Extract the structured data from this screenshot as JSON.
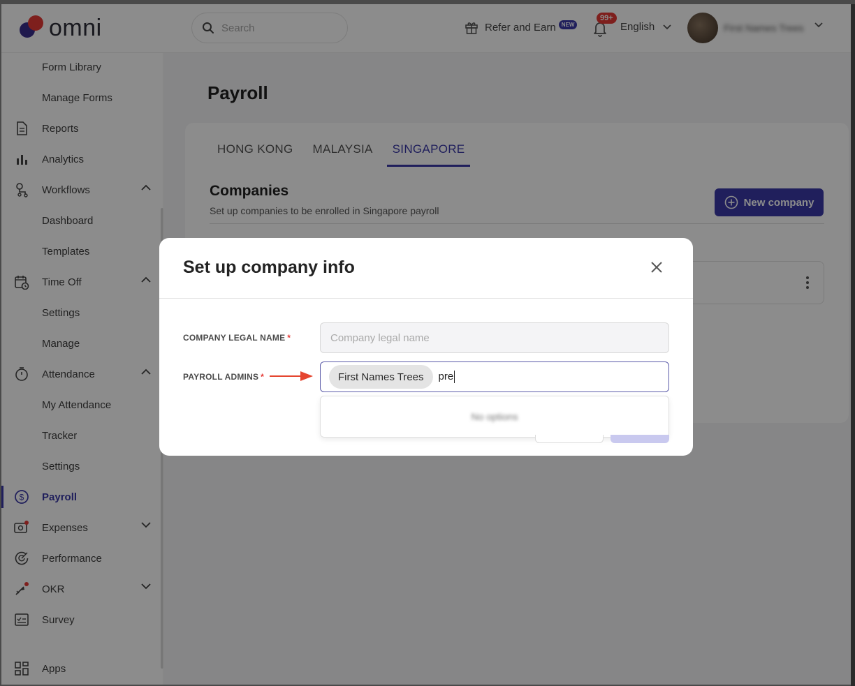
{
  "app": {
    "logo_text": "omni",
    "accent": "#3b3aa8",
    "brand_red": "#e53935"
  },
  "header": {
    "search_placeholder": "Search",
    "refer_label": "Refer and Earn",
    "refer_badge": "NEW",
    "notification_count": "99+",
    "language": "English",
    "user_name": "First Names Trees"
  },
  "sidebar": {
    "items": [
      {
        "label": "Form Library",
        "icon": "none"
      },
      {
        "label": "Manage Forms",
        "icon": "none"
      },
      {
        "label": "Reports",
        "icon": "document-icon"
      },
      {
        "label": "Analytics",
        "icon": "bar-chart-icon"
      },
      {
        "label": "Workflows",
        "icon": "workflow-icon",
        "expanded": true
      },
      {
        "label": "Dashboard",
        "icon": "none"
      },
      {
        "label": "Templates",
        "icon": "none"
      },
      {
        "label": "Time Off",
        "icon": "calendar-clock-icon",
        "expanded": true
      },
      {
        "label": "Settings",
        "icon": "none"
      },
      {
        "label": "Manage",
        "icon": "none"
      },
      {
        "label": "Attendance",
        "icon": "stopwatch-icon",
        "expanded": true
      },
      {
        "label": "My Attendance",
        "icon": "none"
      },
      {
        "label": "Tracker",
        "icon": "none"
      },
      {
        "label": "Settings",
        "icon": "none"
      },
      {
        "label": "Payroll",
        "icon": "dollar-circle-icon",
        "active": true
      },
      {
        "label": "Expenses",
        "icon": "receipt-icon",
        "expanded": false
      },
      {
        "label": "Performance",
        "icon": "performance-icon"
      },
      {
        "label": "OKR",
        "icon": "okr-icon",
        "expanded": false
      },
      {
        "label": "Survey",
        "icon": "survey-icon"
      },
      {
        "label": "Apps",
        "icon": "apps-grid-icon"
      }
    ]
  },
  "main": {
    "page_title": "Payroll",
    "tabs": [
      {
        "label": "HONG KONG",
        "active": false
      },
      {
        "label": "MALAYSIA",
        "active": false
      },
      {
        "label": "SINGAPORE",
        "active": true
      }
    ],
    "section_title": "Companies",
    "section_subtitle": "Set up companies to be enrolled in Singapore payroll",
    "new_company_label": "New company"
  },
  "modal": {
    "title": "Set up company info",
    "legal_name_label": "COMPANY LEGAL NAME",
    "legal_name_placeholder": "Company legal name",
    "legal_name_value": "",
    "admins_label": "PAYROLL ADMINS",
    "admin_chip": "First Names Trees",
    "admin_typed": "pre",
    "dropdown_message": "No options",
    "required_mark": "*"
  }
}
